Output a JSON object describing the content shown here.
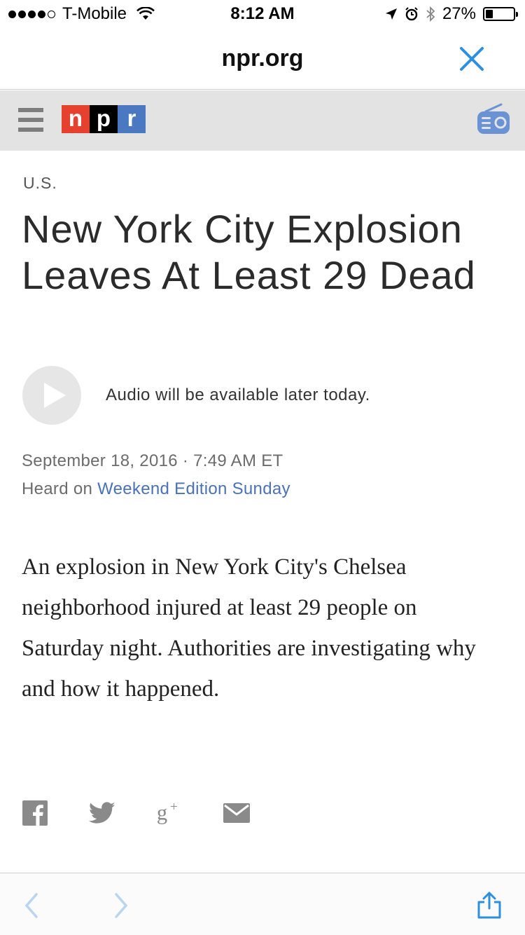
{
  "status_bar": {
    "carrier": "T-Mobile",
    "time": "8:12 AM",
    "battery": "27%",
    "battery_level": 0.27,
    "signal_bars": 4
  },
  "browser": {
    "title": "npr.org",
    "close_icon": "close-icon",
    "accent_color": "#2d8fe0"
  },
  "site_header": {
    "menu_icon": "hamburger-icon",
    "logo_letters": [
      "n",
      "p",
      "r"
    ],
    "logo_colors": [
      "#e5412e",
      "#000000",
      "#4a78c1"
    ],
    "radio_icon": "radio-icon"
  },
  "article": {
    "section": "U.S.",
    "headline": "New York City Explosion Leaves At Least 29 Dead",
    "audio_note": "Audio will be available later today.",
    "date": "September 18, 2016 · 7:49 AM ET",
    "heard_on_prefix": "Heard on",
    "program": "Weekend Edition Sunday",
    "teaser": "An explosion in New York City's Chelsea neighborhood injured at least 29 people on Saturday night. Authorities are investigating why and how it happened."
  },
  "share": {
    "items": [
      "facebook-icon",
      "twitter-icon",
      "google-plus-icon",
      "email-icon"
    ]
  },
  "toolbar": {
    "back_icon": "chevron-left-icon",
    "forward_icon": "chevron-right-icon",
    "share_icon": "share-icon"
  }
}
